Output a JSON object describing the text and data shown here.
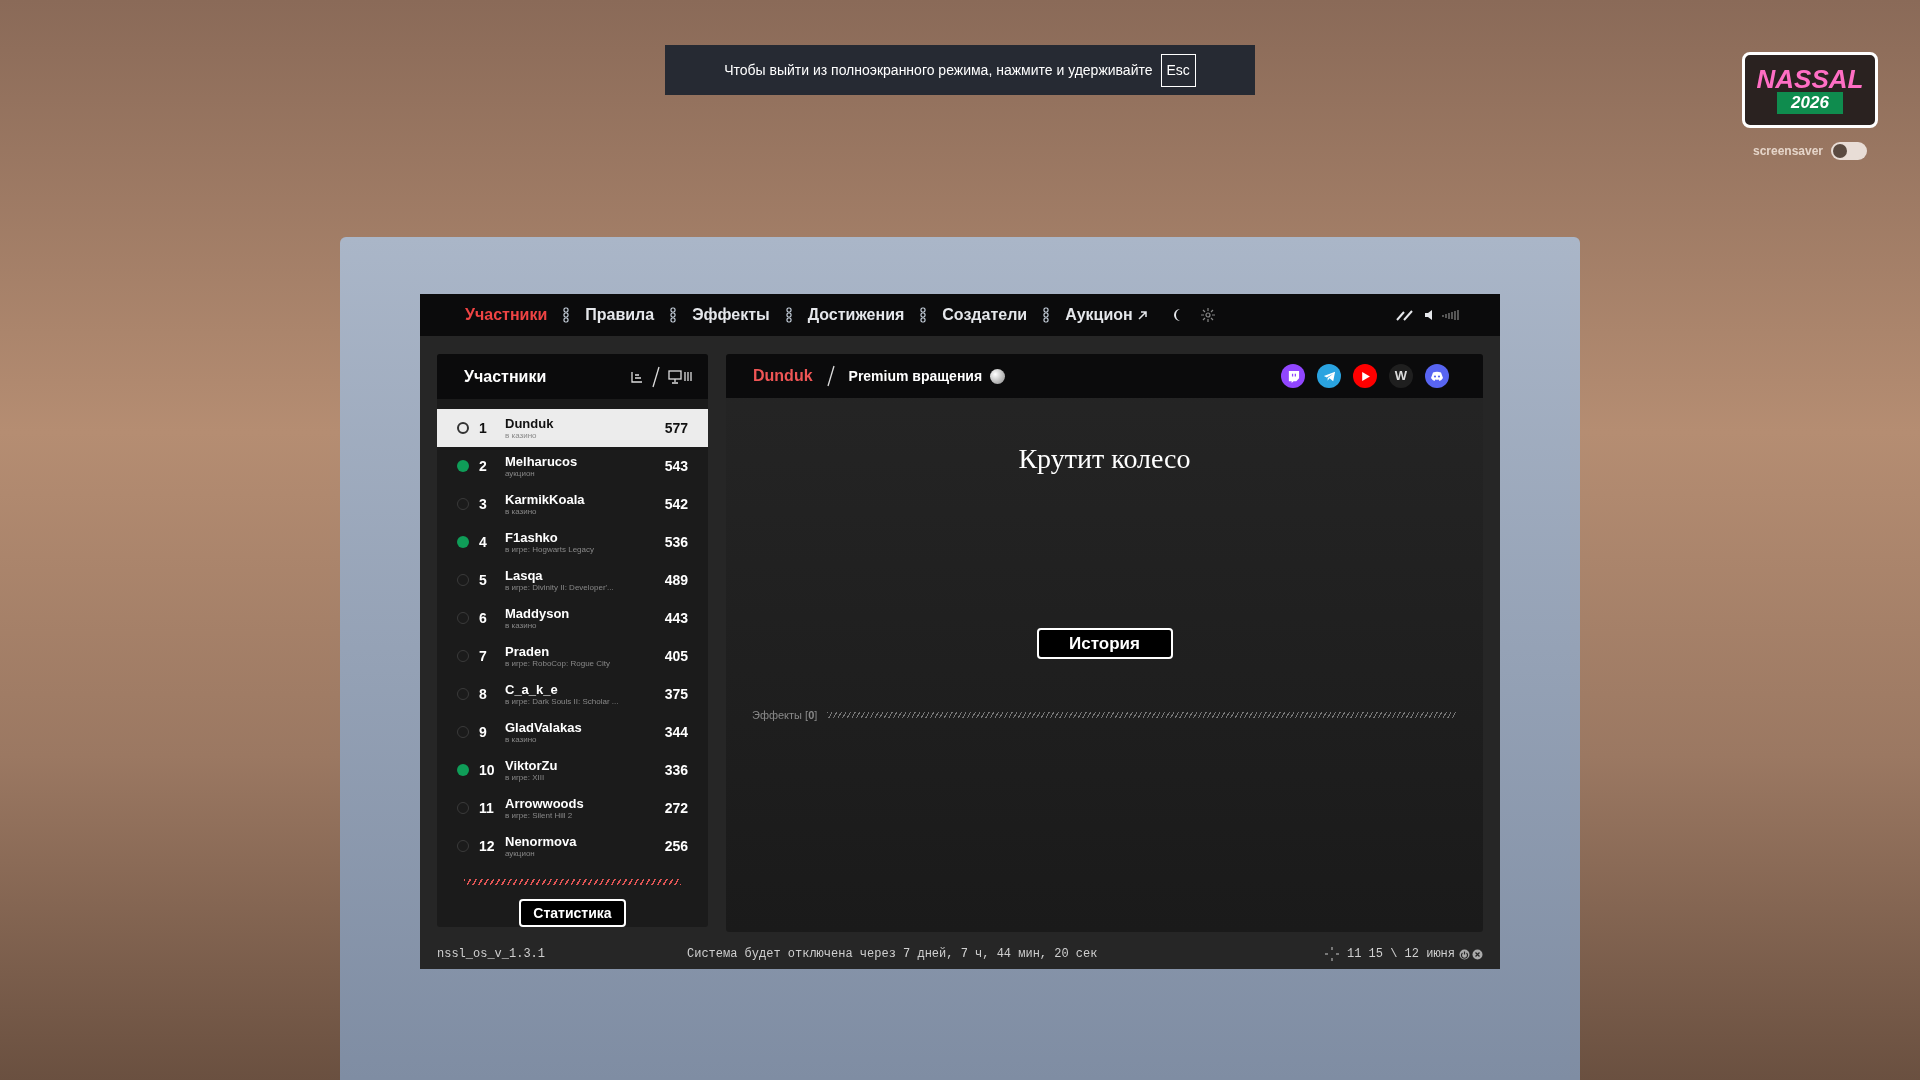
{
  "fullscreen_notice": {
    "text": "Чтобы выйти из полноэкранного режима, нажмите и удерживайте",
    "key": "Esc"
  },
  "logo": {
    "title": "NASSAL",
    "year": "2026"
  },
  "screensaver": {
    "label": "screensaver",
    "on": false
  },
  "nav": {
    "items": [
      {
        "label": "Участники",
        "selected": true,
        "external": false
      },
      {
        "label": "Правила",
        "selected": false,
        "external": false
      },
      {
        "label": "Эффекты",
        "selected": false,
        "external": false
      },
      {
        "label": "Достижения",
        "selected": false,
        "external": false
      },
      {
        "label": "Создатели",
        "selected": false,
        "external": false
      },
      {
        "label": "Аукцион",
        "selected": false,
        "external": true
      }
    ]
  },
  "participants": {
    "title": "Участники",
    "rows": [
      {
        "rank": "1",
        "name": "Dunduk",
        "status": "в казино",
        "score": "577",
        "online": false,
        "selected": true
      },
      {
        "rank": "2",
        "name": "Melharucos",
        "status": "аукцион",
        "score": "543",
        "online": true,
        "selected": false
      },
      {
        "rank": "3",
        "name": "KarmikKoala",
        "status": "в казино",
        "score": "542",
        "online": false,
        "selected": false
      },
      {
        "rank": "4",
        "name": "F1ashko",
        "status": "в игре: Hogwarts Legacy",
        "score": "536",
        "online": true,
        "selected": false
      },
      {
        "rank": "5",
        "name": "Lasqa",
        "status": "в игре: Divinity II: Developer'...",
        "score": "489",
        "online": false,
        "selected": false
      },
      {
        "rank": "6",
        "name": "Maddyson",
        "status": "в казино",
        "score": "443",
        "online": false,
        "selected": false
      },
      {
        "rank": "7",
        "name": "Praden",
        "status": "в игре: RoboCop: Rogue City",
        "score": "405",
        "online": false,
        "selected": false
      },
      {
        "rank": "8",
        "name": "C_a_k_e",
        "status": "в игре: Dark Souls II: Scholar ...",
        "score": "375",
        "online": false,
        "selected": false
      },
      {
        "rank": "9",
        "name": "GladValakas",
        "status": "в казино",
        "score": "344",
        "online": false,
        "selected": false
      },
      {
        "rank": "10",
        "name": "ViktorZu",
        "status": "в игре: XIII",
        "score": "336",
        "online": true,
        "selected": false
      },
      {
        "rank": "11",
        "name": "Arrowwoods",
        "status": "в игре: Silent Hill 2",
        "score": "272",
        "online": false,
        "selected": false
      },
      {
        "rank": "12",
        "name": "Nenormova",
        "status": "аукцион",
        "score": "256",
        "online": false,
        "selected": false
      }
    ],
    "button": "Статистика"
  },
  "detail": {
    "player": "Dunduk",
    "subtitle": "Premium вращения",
    "socials": [
      {
        "kind": "twitch"
      },
      {
        "kind": "telegram"
      },
      {
        "kind": "youtube"
      },
      {
        "kind": "w",
        "label": "W"
      },
      {
        "kind": "discord"
      }
    ],
    "heading": "Крутит колесо",
    "button": "История",
    "effects": "Эффекты [**0**]"
  },
  "status_bar": {
    "version": "nssl_os_v_1.3.1",
    "countdown": "Система будет отключена через 7 дней, 7 ч, 44 мин, 20 сек",
    "time": "11 15 \\ 12 июня"
  }
}
